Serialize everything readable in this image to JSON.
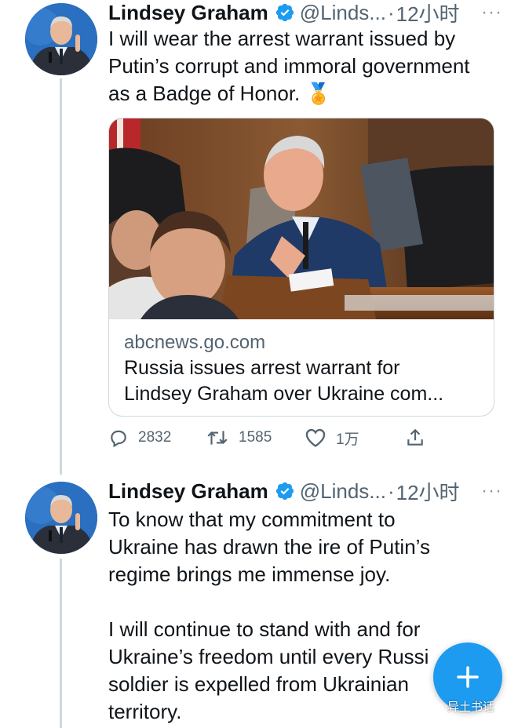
{
  "tweets": [
    {
      "author_name": "Lindsey Graham",
      "handle": "@Linds...",
      "separator": "·",
      "time": "12小时",
      "more_label": "···",
      "text_lines": [
        "I will wear the arrest warrant issued by",
        "Putin’s corrupt and immoral government",
        "as a Badge of Honor. 🏅"
      ],
      "card": {
        "domain": "abcnews.go.com",
        "title_line1": "Russia issues arrest warrant for",
        "title_line2": "Lindsey Graham over Ukraine com..."
      },
      "actions": {
        "reply_count": "2832",
        "retweet_count": "1585",
        "like_count": "1万"
      }
    },
    {
      "author_name": "Lindsey Graham",
      "handle": "@Linds...",
      "separator": "·",
      "time": "12小时",
      "more_label": "···",
      "paragraph1": [
        "To know that my commitment to",
        "Ukraine has drawn the ire of Putin’s",
        "regime brings me immense joy."
      ],
      "paragraph2": [
        "I will continue to stand with and for",
        "Ukraine’s freedom until every Russi",
        "soldier is expelled from Ukrainian",
        "territory."
      ]
    }
  ],
  "watermark": "异土书话",
  "colors": {
    "accent": "#1d9bf0",
    "text": "#0f1419",
    "secondary": "#536471",
    "border": "#cfd9de"
  },
  "icons": [
    "verified-badge-icon",
    "more-icon",
    "reply-icon",
    "retweet-icon",
    "like-icon",
    "share-icon",
    "compose-plus-icon",
    "wechat-icon"
  ]
}
